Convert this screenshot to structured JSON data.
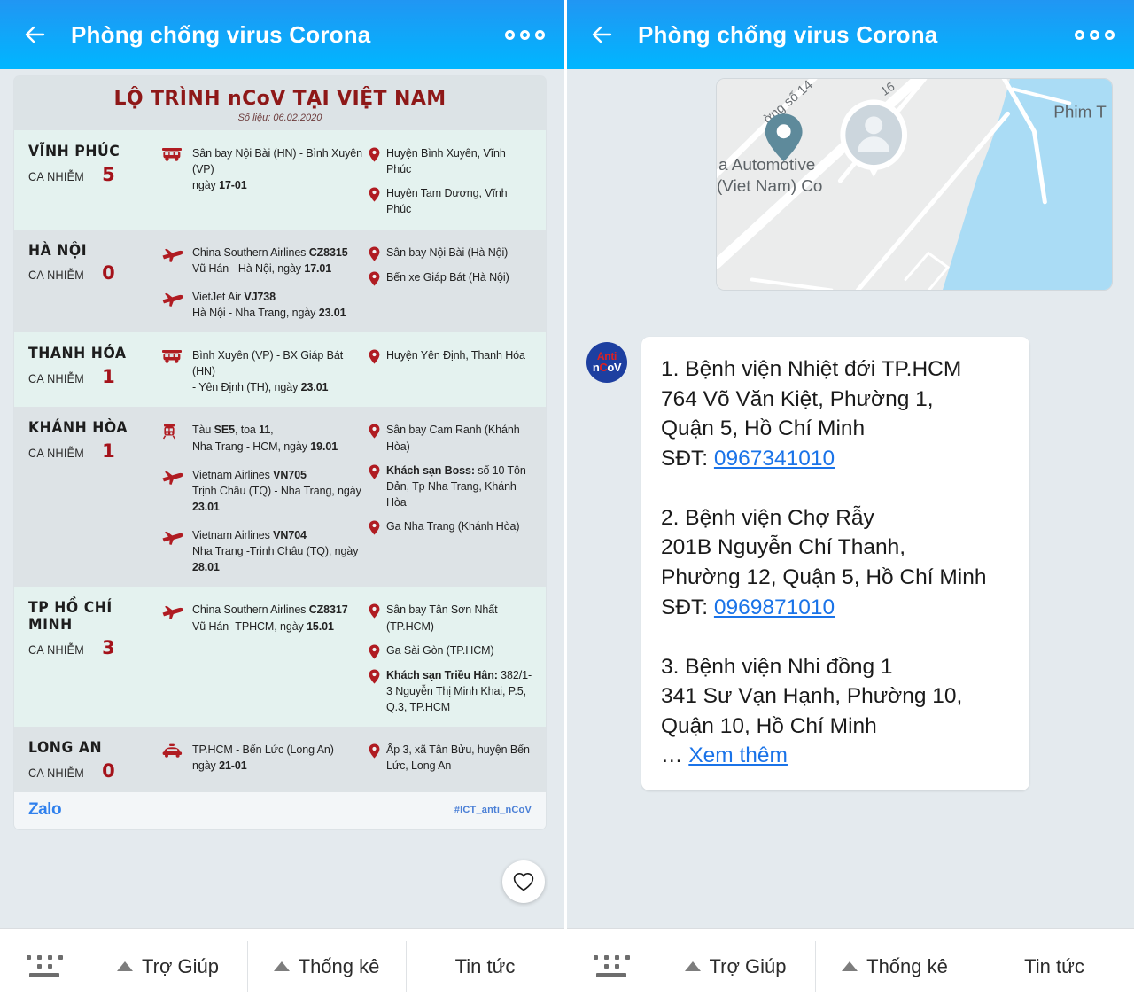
{
  "header": {
    "title": "Phòng chống virus Corona",
    "back_icon": "back-arrow-icon",
    "more_icon": "more-options-icon"
  },
  "infographic": {
    "title": "LỘ TRÌNH nCoV TẠI VIỆT NAM",
    "subtitle": "Số liệu: 06.02.2020",
    "cases_label": "CA NHIỄM",
    "provinces": [
      {
        "name": "VĨNH PHÚC",
        "cases": "5",
        "routes": [
          {
            "icon": "bus-icon",
            "line1": "Sân bay Nội Bài (HN) - Bình Xuyên (VP)",
            "line2_pre": "ngày ",
            "line2_b": "17-01",
            "line2_post": ""
          }
        ],
        "places": [
          {
            "icon": "map-pin-icon",
            "bold": "",
            "text": "Huyện Bình Xuyên, Vĩnh Phúc"
          },
          {
            "icon": "map-pin-icon",
            "bold": "",
            "text": "Huyện Tam Dương, Vĩnh Phúc"
          }
        ]
      },
      {
        "name": "HÀ NỘI",
        "cases": "0",
        "routes": [
          {
            "icon": "plane-icon",
            "line1_pre": "China Southern Airlines ",
            "line1_b": "CZ8315",
            "line2_pre": "Vũ Hán - Hà Nội, ngày ",
            "line2_b": "17.01",
            "line2_post": ""
          },
          {
            "icon": "plane-icon",
            "line1_pre": "VietJet Air ",
            "line1_b": "VJ738",
            "line2_pre": "Hà Nội - Nha Trang, ngày ",
            "line2_b": "23.01",
            "line2_post": ""
          }
        ],
        "places": [
          {
            "icon": "map-pin-icon",
            "bold": "",
            "text": "Sân bay Nội Bài (Hà Nội)"
          },
          {
            "icon": "map-pin-icon",
            "bold": "",
            "text": "Bến xe Giáp Bát (Hà Nội)"
          }
        ]
      },
      {
        "name": "THANH HÓA",
        "cases": "1",
        "routes": [
          {
            "icon": "bus-icon",
            "line1": "Bình Xuyên (VP) - BX Giáp Bát (HN)",
            "line2_pre": "- Yên Định (TH), ngày ",
            "line2_b": "23.01",
            "line2_post": ""
          }
        ],
        "places": [
          {
            "icon": "map-pin-icon",
            "bold": "",
            "text": "Huyện Yên Định, Thanh Hóa"
          }
        ]
      },
      {
        "name": "KHÁNH HÒA",
        "cases": "1",
        "routes": [
          {
            "icon": "train-icon",
            "line1_pre": "Tàu ",
            "line1_b": "SE5",
            "line1_mid": ", toa ",
            "line1_b2": "11",
            "line1_post": ",",
            "line2_pre": "Nha Trang - HCM, ngày ",
            "line2_b": "19.01",
            "line2_post": ""
          },
          {
            "icon": "plane-icon",
            "line1_pre": "Vietnam Airlines ",
            "line1_b": "VN705",
            "line2_pre": "Trịnh Châu (TQ) - Nha Trang, ngày ",
            "line2_b": "23.01",
            "line2_post": ""
          },
          {
            "icon": "plane-icon",
            "line1_pre": "Vietnam Airlines ",
            "line1_b": "VN704",
            "line2_pre": "Nha Trang -Trịnh Châu (TQ), ngày ",
            "line2_b": "28.01",
            "line2_post": ""
          }
        ],
        "places": [
          {
            "icon": "map-pin-icon",
            "bold": "",
            "text": "Sân bay Cam Ranh (Khánh Hòa)"
          },
          {
            "icon": "map-pin-icon",
            "bold": "Khách sạn Boss:",
            "text": " số 10 Tôn Đản, Tp Nha Trang, Khánh Hòa"
          },
          {
            "icon": "map-pin-icon",
            "bold": "",
            "text": "Ga Nha Trang (Khánh Hòa)"
          }
        ]
      },
      {
        "name": "TP HỒ CHÍ MINH",
        "cases": "3",
        "routes": [
          {
            "icon": "plane-icon",
            "line1_pre": "China Southern Airlines ",
            "line1_b": "CZ8317",
            "line2_pre": "Vũ Hán- TPHCM, ngày ",
            "line2_b": "15.01",
            "line2_post": ""
          }
        ],
        "places": [
          {
            "icon": "map-pin-icon",
            "bold": "",
            "text": "Sân bay Tân Sơn Nhất (TP.HCM)"
          },
          {
            "icon": "map-pin-icon",
            "bold": "",
            "text": "Ga Sài Gòn (TP.HCM)"
          },
          {
            "icon": "map-pin-icon",
            "bold": "Khách sạn Triều Hân:",
            "text": " 382/1-3 Nguyễn Thị Minh Khai, P.5, Q.3, TP.HCM"
          }
        ]
      },
      {
        "name": "LONG AN",
        "cases": "0",
        "routes": [
          {
            "icon": "car-icon",
            "line1": "TP.HCM - Bến Lức (Long An)",
            "line2_pre": "ngày ",
            "line2_b": "21-01",
            "line2_post": ""
          }
        ],
        "places": [
          {
            "icon": "map-pin-icon",
            "bold": "",
            "text": "Ấp 3, xã Tân Bửu, huyện Bến Lức, Long An"
          }
        ]
      }
    ],
    "footer": {
      "brand": "Zalo",
      "hashtag": "#ICT_anti_nCoV"
    },
    "favorite_icon": "heart-icon"
  },
  "map": {
    "labels": [
      "ờng số 14",
      "16",
      "a Automotive",
      "(Viet Nam) Co",
      "Phim T"
    ],
    "pin_icon": "map-pin-icon",
    "user_marker_icon": "person-marker-icon",
    "water_color": "#aadcf5",
    "land_color": "#ebecec",
    "road_color": "#ffffff"
  },
  "message": {
    "avatar": {
      "top": "Anti",
      "bottom_pre": "n",
      "bottom_mid": "C",
      "bottom_post": "oV"
    },
    "lines": [
      {
        "type": "text",
        "value": "1. Bệnh viện Nhiệt đới TP.HCM"
      },
      {
        "type": "text",
        "value": "764 Võ Văn Kiệt, Phường 1,"
      },
      {
        "type": "text",
        "value": "Quận 5, Hồ Chí Minh"
      },
      {
        "type": "mixed",
        "prefix": "SĐT: ",
        "link": "0967341010"
      },
      {
        "type": "blank",
        "value": ""
      },
      {
        "type": "text",
        "value": "2. Bệnh viện Chợ Rẫy"
      },
      {
        "type": "text",
        "value": "201B Nguyễn Chí Thanh,"
      },
      {
        "type": "text",
        "value": "Phường 12, Quận 5, Hồ Chí Minh"
      },
      {
        "type": "mixed",
        "prefix": "SĐT: ",
        "link": "0969871010"
      },
      {
        "type": "blank",
        "value": ""
      },
      {
        "type": "text",
        "value": "3. Bệnh viện Nhi đồng 1"
      },
      {
        "type": "text",
        "value": "341 Sư Vạn Hạnh, Phường 10,"
      },
      {
        "type": "text",
        "value": "Quận 10, Hồ Chí Minh"
      },
      {
        "type": "mixed",
        "prefix": "… ",
        "link": "Xem thêm"
      }
    ]
  },
  "toolbar": {
    "keyboard_icon": "keyboard-icon",
    "items": [
      {
        "label": "Trợ Giúp",
        "caret": true
      },
      {
        "label": "Thống kê",
        "caret": true
      },
      {
        "label": "Tin tức",
        "caret": false
      }
    ]
  },
  "colors": {
    "appbar_top": "#2196f3",
    "appbar_bottom": "#00b6ff",
    "title_red": "#8e1818",
    "case_red": "#a4121a",
    "link_blue": "#1a73e8",
    "zalo_blue": "#2f80ed",
    "row_alt": "#e4f2ef",
    "row_norm": "#dde3e6",
    "page_bg": "#e4eaee"
  }
}
